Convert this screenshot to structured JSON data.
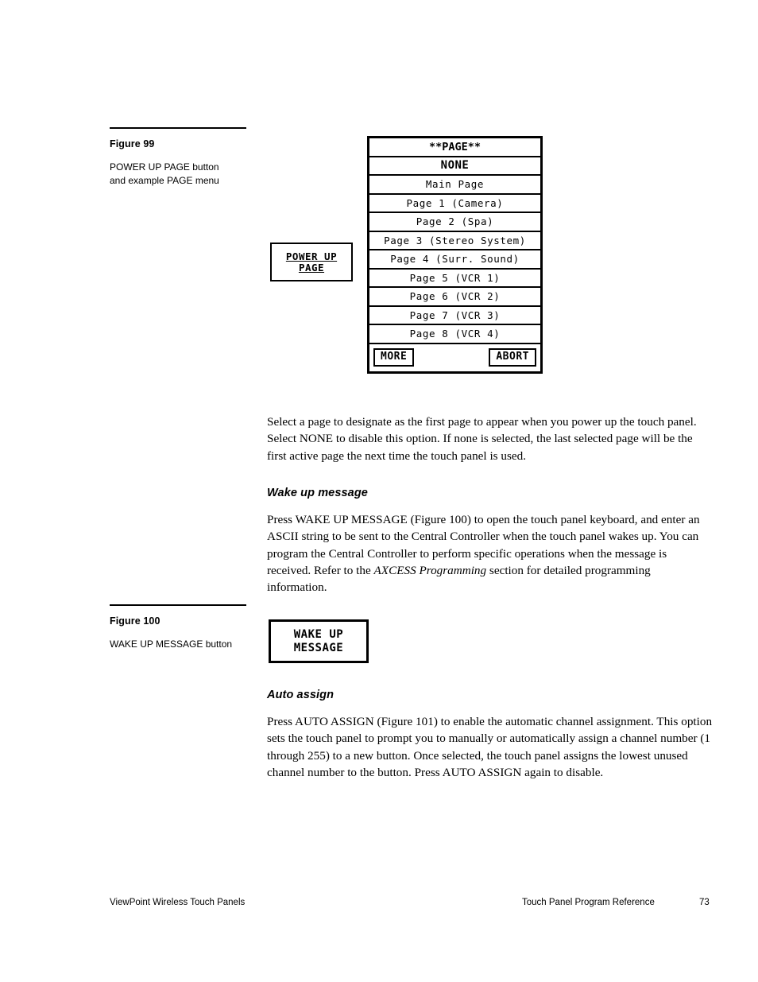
{
  "figures": [
    {
      "id": "figure-99",
      "title": "Figure 99",
      "caption_line1": "POWER UP PAGE button",
      "caption_line2": "and example PAGE menu"
    },
    {
      "id": "figure-100",
      "title": "Figure 100",
      "caption_line1": "WAKE UP MESSAGE button",
      "caption_line2": ""
    }
  ],
  "power_up_page_button": {
    "line1": "POWER UP",
    "line2": "PAGE"
  },
  "wake_up_message_button": {
    "line1": "WAKE UP",
    "line2": "MESSAGE"
  },
  "page_menu": {
    "title": "**PAGE**",
    "none_label": "NONE",
    "entries": [
      "Main Page",
      "Page 1 (Camera)",
      "Page 2 (Spa)",
      "Page 3 (Stereo System)",
      "Page 4 (Surr. Sound)",
      "Page 5 (VCR 1)",
      "Page 6 (VCR 2)",
      "Page 7 (VCR 3)",
      "Page 8 (VCR 4)"
    ],
    "more_label": "MORE",
    "abort_label": "ABORT"
  },
  "body": {
    "paragraph_power_up": "Select a page to designate as the first page to appear when you power up the touch panel. Select NONE to disable this option. If none is selected, the last selected page will be the first active page the next time the touch panel is used.",
    "wake_up_heading": "Wake up message",
    "wake_up_part1": "Press WAKE UP MESSAGE (Figure 100) to open the touch panel keyboard, and enter an ASCII string to be sent to the Central Controller when the touch panel wakes up. You can program the Central Controller to perform specific operations when the message is received. Refer to the ",
    "wake_up_italic": "AXCESS Programming",
    "wake_up_part2": " section for detailed programming information.",
    "auto_assign_heading": "Auto assign",
    "auto_assign_paragraph": "Press AUTO ASSIGN (Figure 101) to enable the automatic channel assignment. This option sets the touch panel to prompt you to manually or automatically assign a channel number (1 through 255) to a new button. Once selected, the touch panel assigns the lowest unused channel number to the button. Press AUTO ASSIGN again to disable."
  },
  "footer": {
    "left": "ViewPoint Wireless Touch Panels",
    "middle": "Touch Panel Program Reference",
    "page_number": "73"
  }
}
